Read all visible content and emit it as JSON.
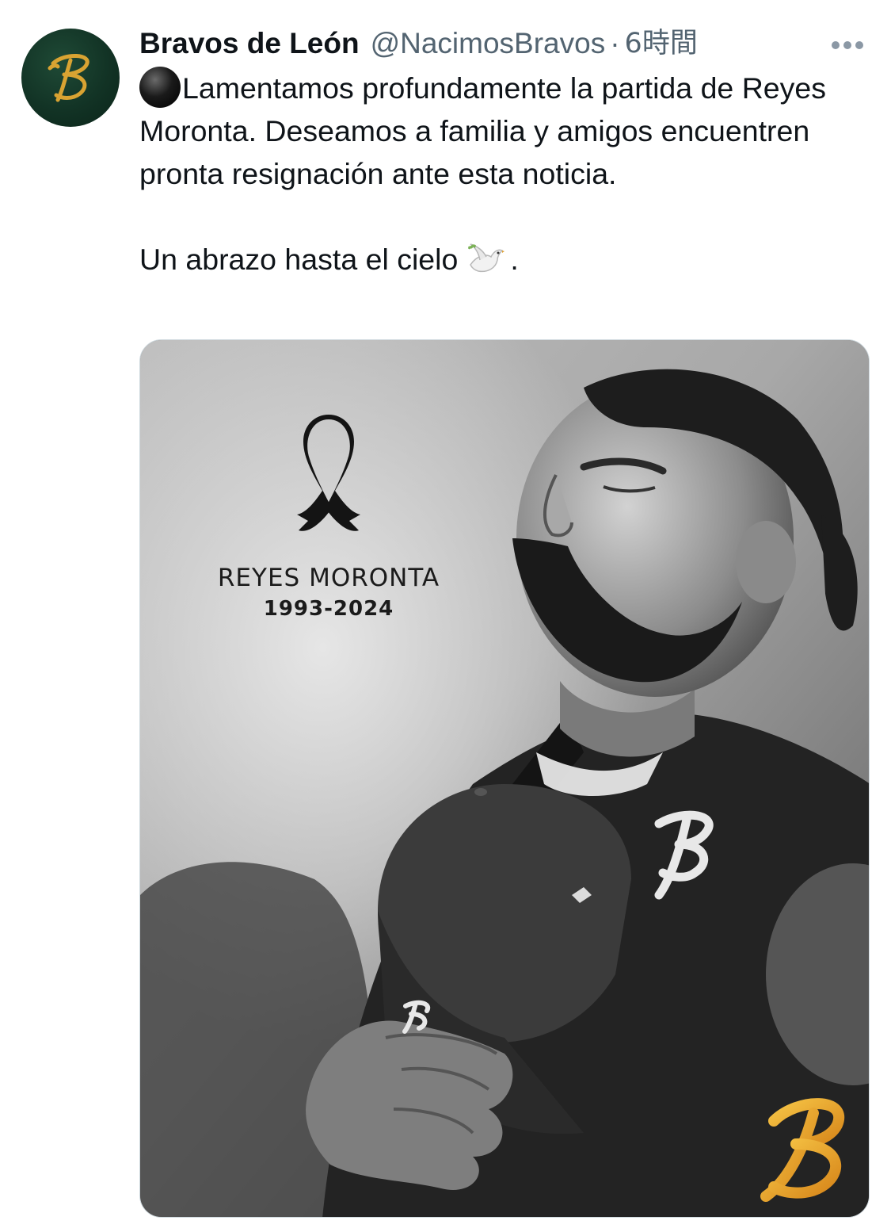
{
  "tweet": {
    "author": {
      "display_name": "Bravos de León",
      "handle": "@NacimosBravos",
      "avatar_icon": "team-b-logo",
      "avatar_colors": {
        "background": "#123325",
        "logo": "#d9a332"
      }
    },
    "separator": "·",
    "timestamp": "6時間",
    "more_icon": "more-horizontal-icon",
    "text": {
      "line1_emoji": "black-circle-emoji",
      "paragraph1": "Lamentamos profundamente la partida de Reyes Moronta. Deseamos a familia y amigos encuentren pronta resignación ante esta noticia.",
      "paragraph2_before": "Un abrazo hasta el cielo",
      "paragraph2_emoji": "dove-emoji",
      "paragraph2_after": "."
    },
    "media": {
      "type": "photo",
      "description_icon": "black-ribbon-icon",
      "overlay_name": "REYES MORONTA",
      "overlay_years": "1993-2024",
      "logo_icon": "team-b-logo",
      "logo_color": "#e6a21f"
    }
  }
}
